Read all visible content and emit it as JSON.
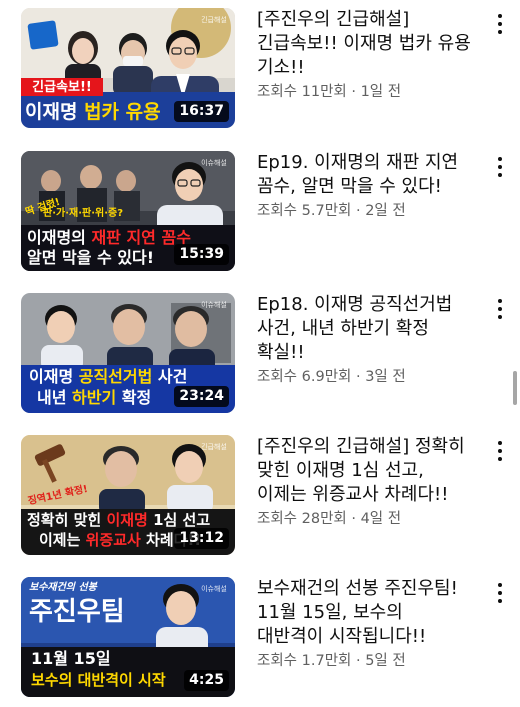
{
  "videos": [
    {
      "title": "[주진우의 긴급해설] 긴급속보!! 이재명 법카 유용 기소!!",
      "stats": "조회수 11만회 · 1일 전",
      "duration": "16:37",
      "thumb_badge": "긴급속보!!",
      "thumb_caption": [
        "이재명 ",
        "법카 유용"
      ],
      "channel_logo": "긴급해설"
    },
    {
      "title": "Ep19. 이재명의 재판 지연 꼼수, 알면 막을 수 있다!",
      "stats": "조회수 5.7만회 · 2일 전",
      "duration": "15:39",
      "thumb_small": "딱 걸렸!",
      "thumb_sub": "판·가·재·판·위·증?",
      "thumb_caption": [
        "이재명의 ",
        "재판 지연 꼼수"
      ],
      "thumb_caption2": "알면 막을 수 있다!",
      "channel_logo": "이슈해설"
    },
    {
      "title": "Ep18. 이재명 공직선거법 사건, 내년 하반기 확정 확실!!",
      "stats": "조회수 6.9만회 · 3일 전",
      "duration": "23:24",
      "thumb_caption": [
        "이재명 ",
        "공직선거법",
        " 사건"
      ],
      "thumb_caption2": [
        "내년 ",
        "하반기",
        " 확정"
      ],
      "channel_logo": "이슈해설"
    },
    {
      "title": "[주진우의 긴급해설] 정확히 맞힌 이재명 1심 선고, 이제는 위증교사 차례다!!",
      "stats": "조회수 28만회 · 4일 전",
      "duration": "13:12",
      "thumb_small": "징역1년 확정!",
      "thumb_caption": [
        "정확히 맞힌 ",
        "이재명",
        " 1심 선고"
      ],
      "thumb_caption2": [
        "이제는 ",
        "위증교사",
        " 차례다!!"
      ],
      "channel_logo": "긴급해설"
    },
    {
      "title": "보수재건의 선봉 주진우팀! 11월 15일, 보수의 대반격이 시작됩니다!!",
      "stats": "조회수 1.7만회 · 5일 전",
      "duration": "4:25",
      "thumb_small": "보수재건의 선봉",
      "thumb_big": "주진우팀",
      "thumb_caption": "11월 15일",
      "thumb_caption2": "보수의 대반격이 시작",
      "channel_logo": "이슈해설"
    }
  ],
  "colors": {
    "title_text": "#0f0f0f",
    "meta_text": "#606060",
    "background": "#ffffff",
    "duration_bg": "#000000"
  },
  "icons": {
    "more_button": "vertical-ellipsis-icon"
  }
}
